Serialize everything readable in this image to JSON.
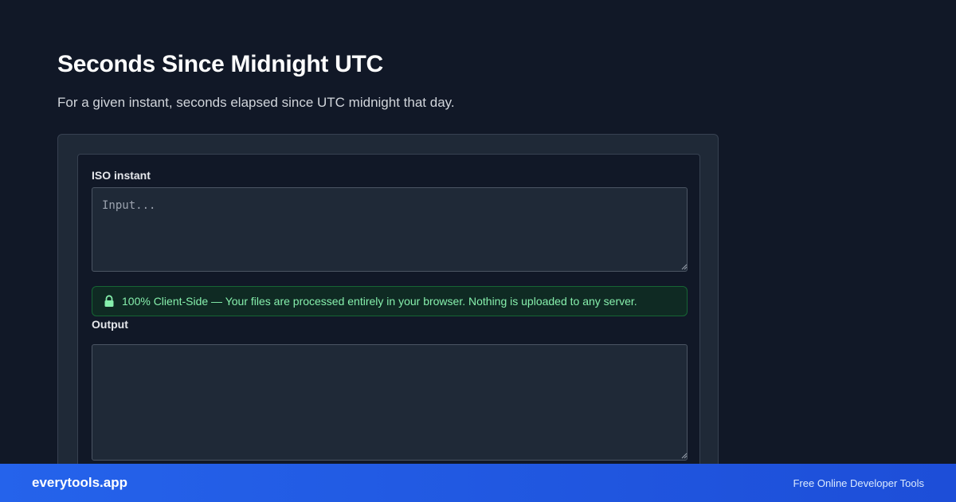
{
  "header": {
    "title": "Seconds Since Midnight UTC",
    "subtitle": "For a given instant, seconds elapsed since UTC midnight that day."
  },
  "tool": {
    "input_label": "ISO instant",
    "input_placeholder": "Input...",
    "input_value": "",
    "notice_text": "100% Client-Side — Your files are processed entirely in your browser. Nothing is uploaded to any server.",
    "output_label": "Output",
    "output_value": ""
  },
  "footer": {
    "brand": "everytools.app",
    "tagline": "Free Online Developer Tools"
  },
  "colors": {
    "background": "#111827",
    "card": "#1f2937",
    "notice_text": "#86efac",
    "footer_blue": "#2563eb"
  },
  "icons": {
    "notice": "lock-icon",
    "textarea_corner": "resize-grip-icon"
  }
}
